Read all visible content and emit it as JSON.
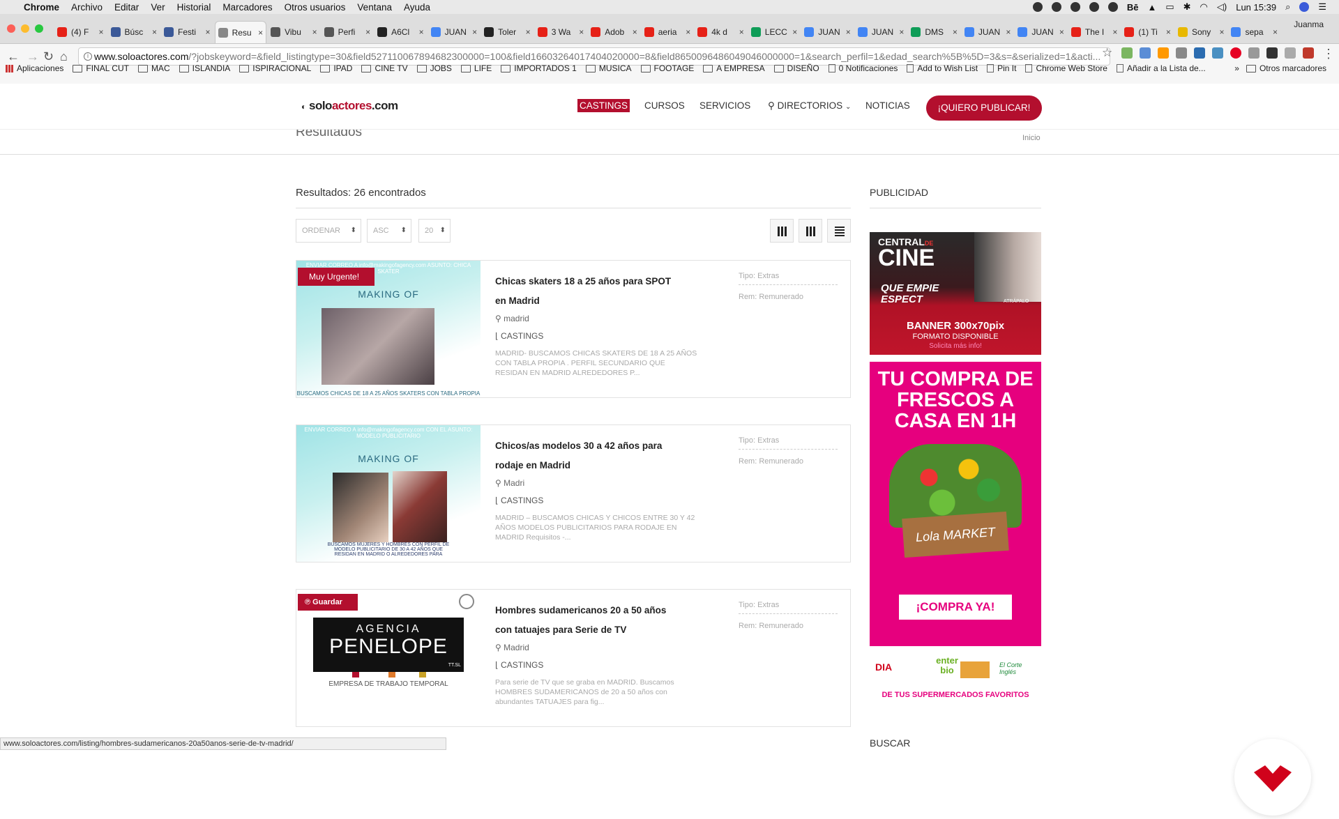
{
  "menubar": {
    "app": "Chrome",
    "items": [
      "Archivo",
      "Editar",
      "Ver",
      "Historial",
      "Marcadores",
      "Otros usuarios",
      "Ventana",
      "Ayuda"
    ],
    "clock": "Lun 15:39"
  },
  "tabs": [
    {
      "label": "(4) F",
      "color": "#e62117"
    },
    {
      "label": "Búsc",
      "color": "#3b5998"
    },
    {
      "label": "Festi",
      "color": "#3b5998"
    },
    {
      "label": "Resu",
      "color": "#888888",
      "active": true
    },
    {
      "label": "Vibu",
      "color": "#555555"
    },
    {
      "label": "Perfi",
      "color": "#555555"
    },
    {
      "label": "A6Cl",
      "color": "#222222"
    },
    {
      "label": "JUAN",
      "color": "#4285f4"
    },
    {
      "label": "Toler",
      "color": "#222222"
    },
    {
      "label": "3 Wa",
      "color": "#e62117"
    },
    {
      "label": "Adob",
      "color": "#e62117"
    },
    {
      "label": "aeria",
      "color": "#e62117"
    },
    {
      "label": "4k d",
      "color": "#e62117"
    },
    {
      "label": "LECC",
      "color": "#0f9d58"
    },
    {
      "label": "JUAN",
      "color": "#4285f4"
    },
    {
      "label": "JUAN",
      "color": "#4285f4"
    },
    {
      "label": "DMS",
      "color": "#0f9d58"
    },
    {
      "label": "JUAN",
      "color": "#4285f4"
    },
    {
      "label": "JUAN",
      "color": "#4285f4"
    },
    {
      "label": "The I",
      "color": "#e62117"
    },
    {
      "label": "(1) Ti",
      "color": "#e62117"
    },
    {
      "label": "Sony",
      "color": "#e8b800"
    },
    {
      "label": "sepa",
      "color": "#4285f4"
    }
  ],
  "user": "Juanma",
  "url": {
    "domain": "www.soloactores.com",
    "path": "/?jobskeyword=&field_listingtype=30&field527110067894682300000=100&field16603264017404020000=8&field8650096486049046000000=1&search_perfil=1&edad_search%5B%5D=3&s=&serialized=1&acti..."
  },
  "bookmarks": [
    "Aplicaciones",
    "FINAL CUT",
    "MAC",
    "ISLANDIA",
    "ISPIRACIONAL",
    "IPAD",
    "CINE TV",
    "JOBS",
    "LIFE",
    "IMPORTADOS 1",
    "MUSICA",
    "FOOTAGE",
    "A EMPRESA",
    "DISEÑO",
    "0 Notificaciones",
    "Add to Wish List",
    "Pin It",
    "Chrome Web Store",
    "Añadir a la Lista de..."
  ],
  "bookmarks_more": "»",
  "bookmarks_other": "Otros marcadores",
  "site": {
    "logo_a": "solo",
    "logo_b": "actores",
    "logo_c": ".com",
    "nav": [
      "CASTINGS",
      "CURSOS",
      "SERVICIOS",
      "DIRECTORIOS",
      "NOTICIAS"
    ],
    "cta": "¡QUIERO PUBLICAR!",
    "page_title": "Resultados",
    "breadcrumb": "Inicio",
    "results": "Resultados: 26 encontrados",
    "sort": {
      "order": "ORDENAR",
      "dir": "ASC",
      "count": "20"
    },
    "listings": [
      {
        "title": "Chicas skaters 18 a 25 años para SPOT en Madrid",
        "location": "madrid",
        "category": "CASTINGS",
        "desc": "MADRID- BUSCAMOS CHICAS SKATERS DE 18 A 25 AÑOS CON TABLA PROPIA . PERFIL SECUNDARIO QUE RESIDAN EN MADRID ALREDEDORES P...",
        "tipo": "Tipo: Extras",
        "rem": "Rem: Remunerado",
        "badge": "Muy Urgente!",
        "img_top": "ENVIAR CORREO A info@makingofagency.com ASUNTO: CHICA SKATER",
        "img_brand": "MAKING OF",
        "img_foot": "BUSCAMOS CHICAS DE 18 A 25 AÑOS SKATERS CON TABLA PROPIA"
      },
      {
        "title": "Chicos/as modelos 30 a 42 años para rodaje en Madrid",
        "location": "Madri",
        "category": "CASTINGS",
        "desc": "MADRID – BUSCAMOS CHICAS Y CHICOS ENTRE 30 Y 42 AÑOS MODELOS PUBLICITARIOS PARA RODAJE EN MADRID Requisitos -...",
        "tipo": "Tipo: Extras",
        "rem": "Rem: Remunerado",
        "img_top": "ENVIAR CORREO A info@makingofagency.com CON EL ASUNTO: MODELO PUBLICITARIO",
        "img_brand": "MAKING OF",
        "img_foot": "BUSCAMOS MUJERES Y HOMBRES CON PERFIL DE MODELO PUBLICITARIO DE 30 A 42 AÑOS QUE RESIDAN EN MADRID O ALREDEDORES PARA"
      },
      {
        "title": "Hombres sudamericanos 20 a 50 años con tatuajes para Serie de TV",
        "location": "Madrid",
        "category": "CASTINGS",
        "desc": "Para serie de TV que se graba en MADRID. Buscamos HOMBRES SUDAMERICANOS de 20 a 50 años con abundantes TATUAJES para fig...",
        "tipo": "Tipo: Extras",
        "rem": "Rem: Remunerado",
        "badge": "Guardar",
        "img_brand_1": "AGENCIA",
        "img_brand_2": "PENELOPE",
        "img_brand_3": "TT.SL",
        "img_foot": "EMPRESA DE TRABAJO TEMPORAL"
      }
    ],
    "sidebar": {
      "pub_title": "PUBLICIDAD",
      "banner1": {
        "line1": "CENTRAL",
        "line1b": "DE",
        "line2": "CINE",
        "line3": "QUE EMPIE",
        "line4": "ESPECT",
        "brand": "ATRÁPALO",
        "size": "BANNER 300x70pix",
        "fmt": "FORMATO DISPONIBLE",
        "req": "Solicita más info!"
      },
      "banner2": {
        "headline": "TU COMPRA DE FRESCOS A CASA EN 1H",
        "brand": "Lola MARKET",
        "cta": "¡COMPRA YA!",
        "stores": [
          "DIA",
          "enter bio",
          "El Corte Inglés"
        ],
        "footer": "DE TUS SUPERMERCADOS FAVORITOS"
      },
      "search_title": "BUSCAR"
    }
  },
  "status_url": "www.soloactores.com/listing/hombres-sudamericanos-20a50anos-serie-de-tv-madrid/"
}
